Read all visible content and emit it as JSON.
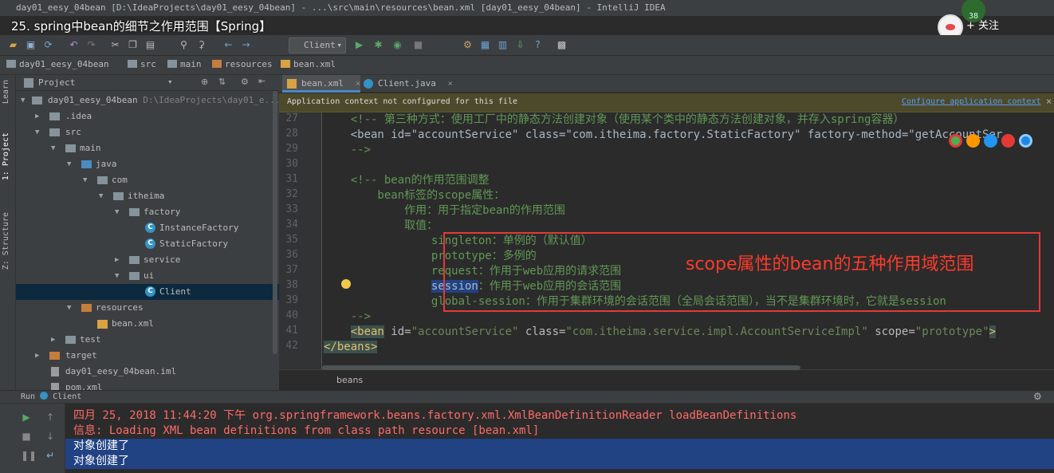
{
  "window_title": "day01_eesy_04bean [D:\\IdeaProjects\\day01_eesy_04bean] - ...\\src\\main\\resources\\bean.xml [day01_eesy_04bean] - IntelliJ IDEA",
  "video_overlay": {
    "title": "25. spring中bean的细节之作用范围【Spring】",
    "follow_label": "+ 关注",
    "badge": "38"
  },
  "toolbar": {
    "run_config": "Client"
  },
  "breadcrumb": [
    "day01_eesy_04bean",
    "src",
    "main",
    "resources",
    "bean.xml"
  ],
  "left_strip": {
    "learn": "Learn",
    "project": "1: Project",
    "structure": "Z: Structure"
  },
  "project_panel": {
    "header": "Project",
    "tree": [
      {
        "name": "day01_eesy_04bean",
        "path": "D:\\IdeaProjects\\day01_e..."
      },
      {
        "name": ".idea"
      },
      {
        "name": "src"
      },
      {
        "name": "main"
      },
      {
        "name": "java"
      },
      {
        "name": "com"
      },
      {
        "name": "itheima"
      },
      {
        "name": "factory"
      },
      {
        "name": "InstanceFactory"
      },
      {
        "name": "StaticFactory"
      },
      {
        "name": "service"
      },
      {
        "name": "ui"
      },
      {
        "name": "Client"
      },
      {
        "name": "resources"
      },
      {
        "name": "bean.xml"
      },
      {
        "name": "test"
      },
      {
        "name": "target"
      },
      {
        "name": "day01_eesy_04bean.iml"
      },
      {
        "name": "pom.xml"
      }
    ]
  },
  "editor": {
    "tabs": [
      {
        "label": "bean.xml"
      },
      {
        "label": "Client.java"
      }
    ],
    "notification": {
      "message": "Application context not configured for this file",
      "link": "Configure application context"
    },
    "line_numbers": [
      "27",
      "28",
      "29",
      "30",
      "31",
      "32",
      "33",
      "34",
      "35",
      "36",
      "37",
      "38",
      "39",
      "40",
      "41",
      "42"
    ],
    "lines": {
      "l27": "    <!-- 第三种方式：使用工厂中的静态方法创建对象（使用某个类中的静态方法创建对象，并存入spring容器）",
      "l28": "    <bean id=\"accountService\" class=\"com.itheima.factory.StaticFactory\" factory-method=\"getAccountSer",
      "l29": "    -->",
      "l31": "    <!-- bean的作用范围调整",
      "l32": "        bean标签的scope属性：",
      "l33": "            作用：用于指定bean的作用范围",
      "l34": "            取值：",
      "l35": "                singleton：单例的（默认值）",
      "l36": "                prototype：多例的",
      "l37": "                request：作用于web应用的请求范围",
      "l38_word": "session",
      "l38_rest": "：作用于web应用的会话范围",
      "l39": "                global-session：作用于集群环境的会话范围（全局会话范围），当不是集群环境时，它就是session",
      "l40": "    -->",
      "l41_tag": "<bean",
      "l41_id_attr": " id=",
      "l41_id_val": "\"accountService\"",
      "l41_class_attr": " class=",
      "l41_class_val": "\"com.itheima.service.impl.AccountServiceImpl\"",
      "l41_scope_attr": " scope=",
      "l41_scope_val": "\"prototype\"",
      "l41_end": ">",
      "l42": "</beans>"
    },
    "annotation": "scope属性的bean的五种作用域范围",
    "footer_breadcrumb": "beans"
  },
  "run_panel": {
    "title": "Run",
    "config": "Client",
    "console": [
      "四月 25, 2018 11:44:20 下午 org.springframework.beans.factory.xml.XmlBeanDefinitionReader loadBeanDefinitions",
      "信息: Loading XML bean definitions from class path resource [bean.xml]",
      "对象创建了",
      "对象创建了"
    ]
  }
}
